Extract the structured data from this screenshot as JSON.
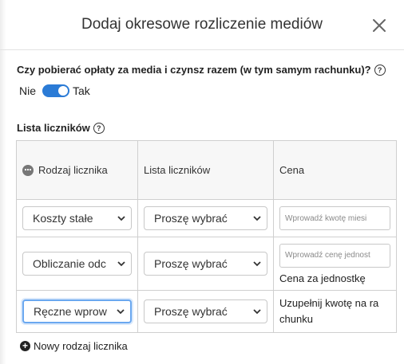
{
  "dialog": {
    "title": "Dodaj okresowe rozliczenie mediów"
  },
  "question": {
    "label": "Czy pobierać opłaty za media i czynsz razem (w tym samym rachunku)?",
    "help": "?",
    "toggle": {
      "off_label": "Nie",
      "on_label": "Tak",
      "value": "Tak"
    }
  },
  "meters": {
    "title": "Lista liczników",
    "help": "?",
    "columns": [
      "Rodzaj licznika",
      "Lista liczników",
      "Cena"
    ],
    "rows": [
      {
        "type": "Koszty stałe",
        "meter": "Proszę wybrać",
        "price_placeholder": "Wprowadź kwotę miesi",
        "price_note": ""
      },
      {
        "type": "Obliczanie odc",
        "meter": "Proszę wybrać",
        "price_placeholder": "Wprowadź cenę jednost",
        "price_note": "Cena za jednostkę"
      },
      {
        "type": "Ręczne wprow",
        "meter": "Proszę wybrać",
        "price_text_1": "Uzupełnij kwotę na ra",
        "price_text_2": "chunku"
      }
    ],
    "add_label": "Nowy rodzaj licznika"
  },
  "icons": {
    "close": "close-icon",
    "help": "question-circle-icon",
    "meter_type": "meter-type-icon",
    "chevron": "chevron-down-icon",
    "add": "plus-circle-icon"
  },
  "colors": {
    "toggle_on": "#2b7bd6",
    "focus_border": "#6aa8f0",
    "table_header_bg": "#f7f7f7"
  }
}
